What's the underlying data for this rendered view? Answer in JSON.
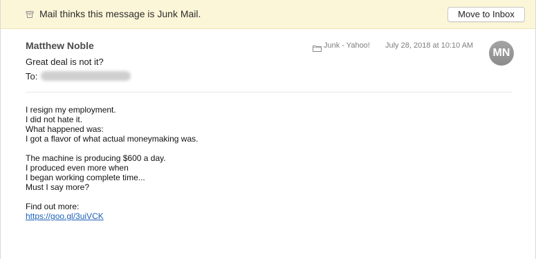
{
  "banner": {
    "text": "Mail thinks this message is Junk Mail.",
    "button_label": "Move to Inbox",
    "icon": "junk-bin-icon"
  },
  "header": {
    "sender": "Matthew Noble",
    "subject": "Great deal is not it?",
    "to_label": "To:",
    "folder_icon": "folder-icon",
    "folder": "Junk - Yahoo!",
    "date": "July 28, 2018 at 10:10 AM",
    "avatar_initials": "MN"
  },
  "body": {
    "paragraph1": [
      "I resign my employment.",
      "I did not hate it.",
      "What happened was:",
      "I got a flavor of what actual moneymaking was."
    ],
    "paragraph2": [
      "The machine is producing $600 a day.",
      "I produced even more when",
      "I began working complete time...",
      "Must I say more?"
    ],
    "find_out": "Find out more:",
    "link": "https://goo.gl/3uiVCK"
  },
  "colors": {
    "banner_bg": "#fcf6d8",
    "link": "#1d5fb8",
    "avatar": "#999999"
  }
}
